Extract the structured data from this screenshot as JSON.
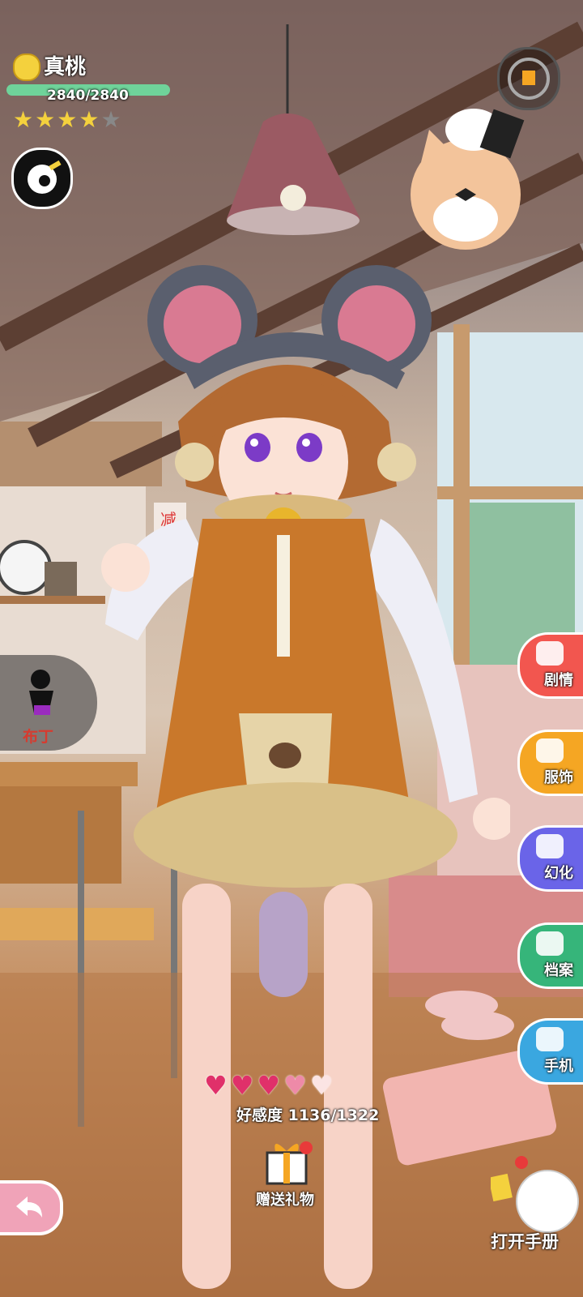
{
  "character": {
    "name": "真桃",
    "hp": "2840/2840",
    "hp_fraction": 1.0,
    "stars_filled": 4,
    "stars_total": 5
  },
  "left_companion": {
    "label": "布丁"
  },
  "side_menu": [
    {
      "id": "story",
      "label": "剧情",
      "color": "#f2564f"
    },
    {
      "id": "outfit",
      "label": "服饰",
      "color": "#f5a623"
    },
    {
      "id": "transform",
      "label": "幻化",
      "color": "#6a64e8"
    },
    {
      "id": "profile",
      "label": "档案",
      "color": "#36b57a"
    },
    {
      "id": "phone",
      "label": "手机",
      "color": "#3aa7e0"
    }
  ],
  "affection": {
    "label": "好感度 1136/1322",
    "hearts_full": 3,
    "hearts_half": 1,
    "hearts_total": 5
  },
  "gift": {
    "label": "赠送礼物"
  },
  "handbook": {
    "label": "打开手册"
  },
  "colors": {
    "hp_fill": "#6fd39a",
    "heart": "#e0306a",
    "back_button": "#f0a3b8"
  }
}
